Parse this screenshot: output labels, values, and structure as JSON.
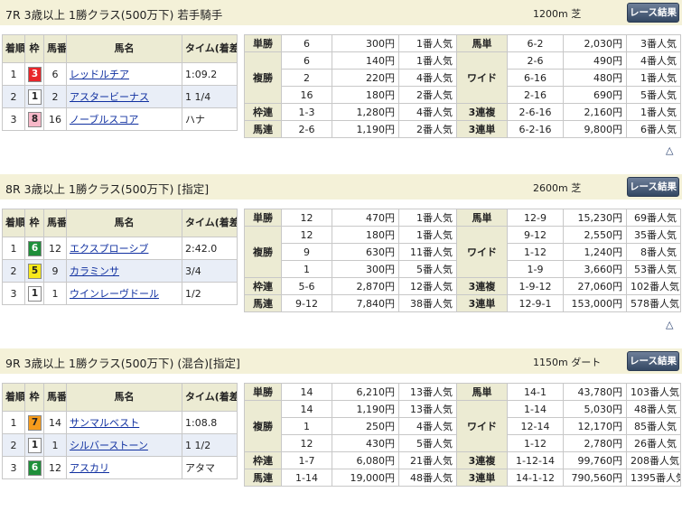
{
  "races": [
    {
      "name": "7R 3歳以上 1勝クラス(500万下) 若手騎手",
      "distance": "1200m 芝",
      "button": "レース結果",
      "headers": [
        "着順",
        "枠",
        "馬番",
        "馬名",
        "タイム(着差)"
      ],
      "rows": [
        {
          "pos": "1",
          "waku": "3",
          "num": "6",
          "horse": "レッドルチア",
          "time": "1:09.2"
        },
        {
          "pos": "2",
          "waku": "1",
          "num": "2",
          "horse": "アスタービーナス",
          "time": "1 1/4"
        },
        {
          "pos": "3",
          "waku": "8",
          "num": "16",
          "horse": "ノーブルスコア",
          "time": "ハナ"
        }
      ],
      "payouts": {
        "tansho": {
          "label": "単勝",
          "nums": [
            "6"
          ],
          "pays": [
            "300円"
          ],
          "pops": [
            "1番人気"
          ]
        },
        "fukusho": {
          "label": "複勝",
          "nums": [
            "6",
            "2",
            "16"
          ],
          "pays": [
            "140円",
            "220円",
            "180円"
          ],
          "pops": [
            "1番人気",
            "4番人気",
            "2番人気"
          ]
        },
        "wakuren": {
          "label": "枠連",
          "nums": [
            "1-3"
          ],
          "pays": [
            "1,280円"
          ],
          "pops": [
            "4番人気"
          ]
        },
        "umaren": {
          "label": "馬連",
          "nums": [
            "2-6"
          ],
          "pays": [
            "1,190円"
          ],
          "pops": [
            "2番人気"
          ]
        },
        "umatan": {
          "label": "馬単",
          "nums": [
            "6-2"
          ],
          "pays": [
            "2,030円"
          ],
          "pops": [
            "3番人気"
          ]
        },
        "wide": {
          "label": "ワイド",
          "nums": [
            "2-6",
            "6-16",
            "2-16"
          ],
          "pays": [
            "490円",
            "480円",
            "690円"
          ],
          "pops": [
            "4番人気",
            "1番人気",
            "5番人気"
          ]
        },
        "sanrenpuku": {
          "label": "3連複",
          "nums": [
            "2-6-16"
          ],
          "pays": [
            "2,160円"
          ],
          "pops": [
            "1番人気"
          ]
        },
        "sanrentan": {
          "label": "3連単",
          "nums": [
            "6-2-16"
          ],
          "pays": [
            "9,800円"
          ],
          "pops": [
            "6番人気"
          ]
        }
      }
    },
    {
      "name": "8R 3歳以上 1勝クラス(500万下) [指定]",
      "distance": "2600m 芝",
      "button": "レース結果",
      "headers": [
        "着順",
        "枠",
        "馬番",
        "馬名",
        "タイム(着差)"
      ],
      "rows": [
        {
          "pos": "1",
          "waku": "6",
          "num": "12",
          "horse": "エクスプローシブ",
          "time": "2:42.0"
        },
        {
          "pos": "2",
          "waku": "5",
          "num": "9",
          "horse": "カラミンサ",
          "time": "3/4"
        },
        {
          "pos": "3",
          "waku": "1",
          "num": "1",
          "horse": "ウインレーヴドール",
          "time": "1/2"
        }
      ],
      "payouts": {
        "tansho": {
          "label": "単勝",
          "nums": [
            "12"
          ],
          "pays": [
            "470円"
          ],
          "pops": [
            "1番人気"
          ]
        },
        "fukusho": {
          "label": "複勝",
          "nums": [
            "12",
            "9",
            "1"
          ],
          "pays": [
            "180円",
            "630円",
            "300円"
          ],
          "pops": [
            "1番人気",
            "11番人気",
            "5番人気"
          ]
        },
        "wakuren": {
          "label": "枠連",
          "nums": [
            "5-6"
          ],
          "pays": [
            "2,870円"
          ],
          "pops": [
            "12番人気"
          ]
        },
        "umaren": {
          "label": "馬連",
          "nums": [
            "9-12"
          ],
          "pays": [
            "7,840円"
          ],
          "pops": [
            "38番人気"
          ]
        },
        "umatan": {
          "label": "馬単",
          "nums": [
            "12-9"
          ],
          "pays": [
            "15,230円"
          ],
          "pops": [
            "69番人気"
          ]
        },
        "wide": {
          "label": "ワイド",
          "nums": [
            "9-12",
            "1-12",
            "1-9"
          ],
          "pays": [
            "2,550円",
            "1,240円",
            "3,660円"
          ],
          "pops": [
            "35番人気",
            "8番人気",
            "53番人気"
          ]
        },
        "sanrenpuku": {
          "label": "3連複",
          "nums": [
            "1-9-12"
          ],
          "pays": [
            "27,060円"
          ],
          "pops": [
            "102番人気"
          ]
        },
        "sanrentan": {
          "label": "3連単",
          "nums": [
            "12-9-1"
          ],
          "pays": [
            "153,000円"
          ],
          "pops": [
            "578番人気"
          ]
        }
      }
    },
    {
      "name": "9R 3歳以上 1勝クラス(500万下) (混合)[指定]",
      "distance": "1150m ダート",
      "button": "レース結果",
      "headers": [
        "着順",
        "枠",
        "馬番",
        "馬名",
        "タイム(着差)"
      ],
      "rows": [
        {
          "pos": "1",
          "waku": "7",
          "num": "14",
          "horse": "サンマルベスト",
          "time": "1:08.8"
        },
        {
          "pos": "2",
          "waku": "1",
          "num": "1",
          "horse": "シルバーストーン",
          "time": "1 1/2"
        },
        {
          "pos": "3",
          "waku": "6",
          "num": "12",
          "horse": "アスカリ",
          "time": "アタマ"
        }
      ],
      "payouts": {
        "tansho": {
          "label": "単勝",
          "nums": [
            "14"
          ],
          "pays": [
            "6,210円"
          ],
          "pops": [
            "13番人気"
          ]
        },
        "fukusho": {
          "label": "複勝",
          "nums": [
            "14",
            "1",
            "12"
          ],
          "pays": [
            "1,190円",
            "250円",
            "430円"
          ],
          "pops": [
            "13番人気",
            "4番人気",
            "5番人気"
          ]
        },
        "wakuren": {
          "label": "枠連",
          "nums": [
            "1-7"
          ],
          "pays": [
            "6,080円"
          ],
          "pops": [
            "21番人気"
          ]
        },
        "umaren": {
          "label": "馬連",
          "nums": [
            "1-14"
          ],
          "pays": [
            "19,000円"
          ],
          "pops": [
            "48番人気"
          ]
        },
        "umatan": {
          "label": "馬単",
          "nums": [
            "14-1"
          ],
          "pays": [
            "43,780円"
          ],
          "pops": [
            "103番人気"
          ]
        },
        "wide": {
          "label": "ワイド",
          "nums": [
            "1-14",
            "12-14",
            "1-12"
          ],
          "pays": [
            "5,030円",
            "12,170円",
            "2,780円"
          ],
          "pops": [
            "48番人気",
            "85番人気",
            "26番人気"
          ]
        },
        "sanrenpuku": {
          "label": "3連複",
          "nums": [
            "1-12-14"
          ],
          "pays": [
            "99,760円"
          ],
          "pops": [
            "208番人気"
          ]
        },
        "sanrentan": {
          "label": "3連単",
          "nums": [
            "14-1-12"
          ],
          "pays": [
            "790,560円"
          ],
          "pops": [
            "1395番人気"
          ]
        }
      }
    }
  ],
  "scroll_top_icon": "△",
  "waku_colors": {
    "1": {
      "bg": "#ffffff",
      "fg": "#222222"
    },
    "2": {
      "bg": "#222222",
      "fg": "#ffffff"
    },
    "3": {
      "bg": "#e8262a",
      "fg": "#ffffff"
    },
    "4": {
      "bg": "#1a56c4",
      "fg": "#ffffff"
    },
    "5": {
      "bg": "#f7e81a",
      "fg": "#222222"
    },
    "6": {
      "bg": "#1f8f3a",
      "fg": "#ffffff"
    },
    "7": {
      "bg": "#f59b1c",
      "fg": "#222222"
    },
    "8": {
      "bg": "#f7b8c8",
      "fg": "#222222"
    }
  }
}
